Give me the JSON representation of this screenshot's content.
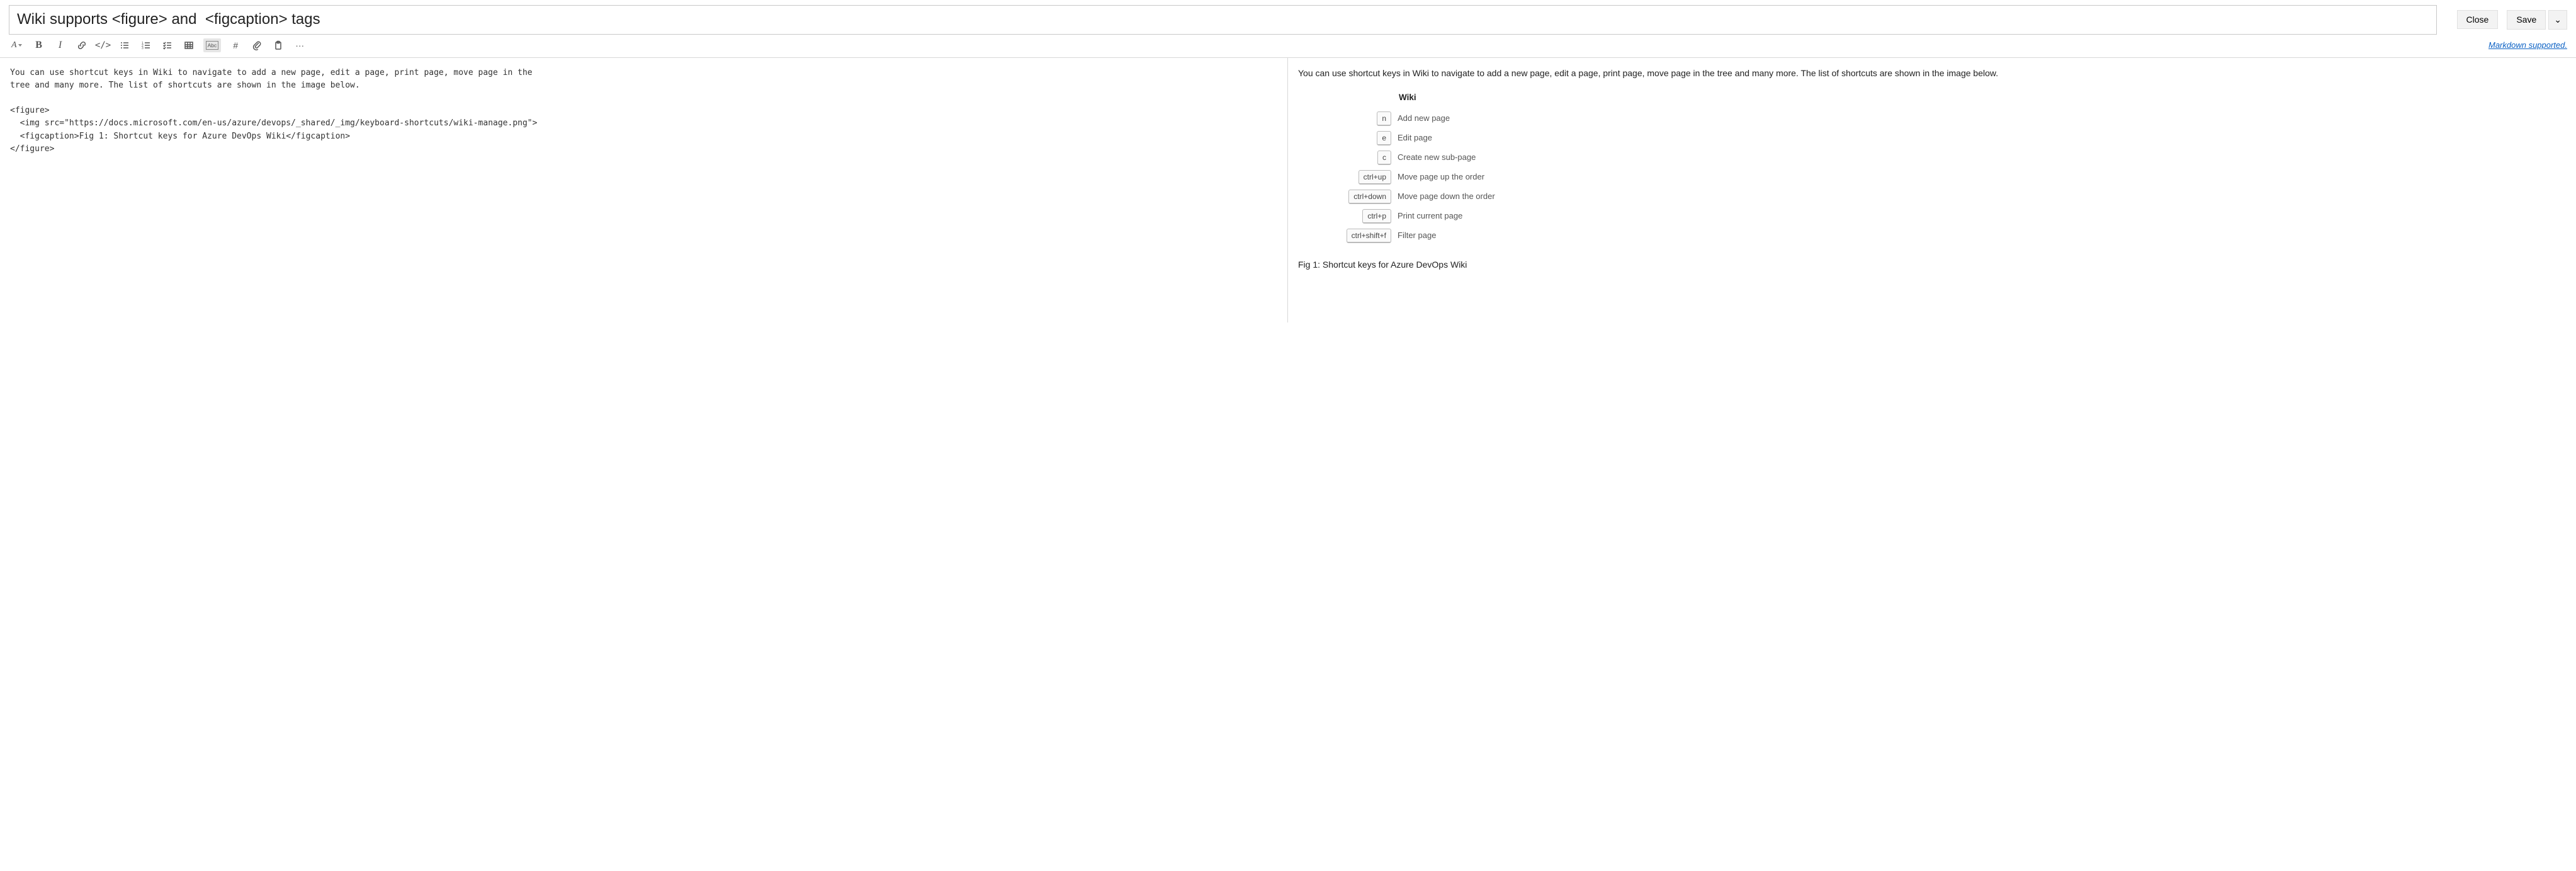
{
  "header": {
    "title_value": "Wiki supports <figure> and  <figcaption> tags",
    "close_label": "Close",
    "save_label": "Save"
  },
  "toolbar": {
    "markdown_link": "Markdown supported.",
    "font_color_label": "A",
    "bold_label": "B",
    "italic_label": "I",
    "code_label": "</>",
    "abc_label": "Abc",
    "hash_label": "#",
    "more_label": "···"
  },
  "editor": {
    "lines": [
      "You can use shortcut keys in Wiki to navigate to add a new page, edit a page, print page, move page in the",
      "tree and many more. The list of shortcuts are shown in the image below.",
      "",
      "<figure>",
      "  <img src=\"https://docs.microsoft.com/en-us/azure/devops/_shared/_img/keyboard-shortcuts/wiki-manage.png\">",
      "  <figcaption>Fig 1: Shortcut keys for Azure DevOps Wiki</figcaption>",
      "</figure>"
    ]
  },
  "preview": {
    "paragraph": "You can use shortcut keys in Wiki to navigate to add a new page, edit a page, print page, move page in the tree and many more. The list of shortcuts are shown in the image below.",
    "shortcut_title": "Wiki",
    "shortcuts": [
      {
        "key": "n",
        "desc": "Add new page"
      },
      {
        "key": "e",
        "desc": "Edit page"
      },
      {
        "key": "c",
        "desc": "Create new sub-page"
      },
      {
        "key": "ctrl+up",
        "desc": "Move page up the order"
      },
      {
        "key": "ctrl+down",
        "desc": "Move page down the order"
      },
      {
        "key": "ctrl+p",
        "desc": "Print current page"
      },
      {
        "key": "ctrl+shift+f",
        "desc": "Filter page"
      }
    ],
    "figcaption": "Fig 1: Shortcut keys for Azure DevOps Wiki"
  }
}
